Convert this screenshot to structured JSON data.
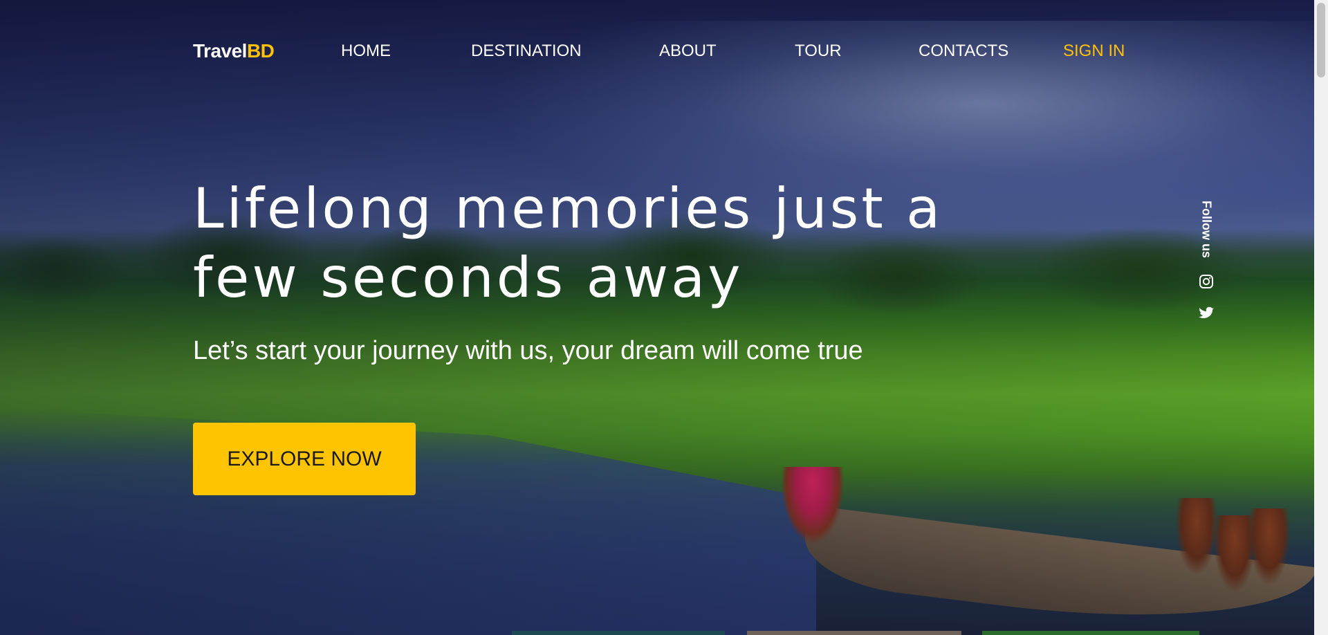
{
  "nav": {
    "logo_main": "Travel",
    "logo_accent": "BD",
    "items": [
      {
        "label": "HOME"
      },
      {
        "label": "DESTINATION"
      },
      {
        "label": "ABOUT"
      },
      {
        "label": "TOUR"
      },
      {
        "label": "CONTACTS"
      }
    ],
    "signin_label": "SIGN IN"
  },
  "hero": {
    "title": "Lifelong memories just a few seconds away",
    "subtitle": "Let’s start your journey with us, your dream will come true",
    "cta_label": "EXPLORE NOW"
  },
  "social": {
    "label": "Follow us",
    "icons": [
      "instagram-icon",
      "twitter-icon"
    ]
  },
  "colors": {
    "accent": "#ffc107",
    "cta_bg": "#ffc400",
    "text": "#ffffff"
  }
}
